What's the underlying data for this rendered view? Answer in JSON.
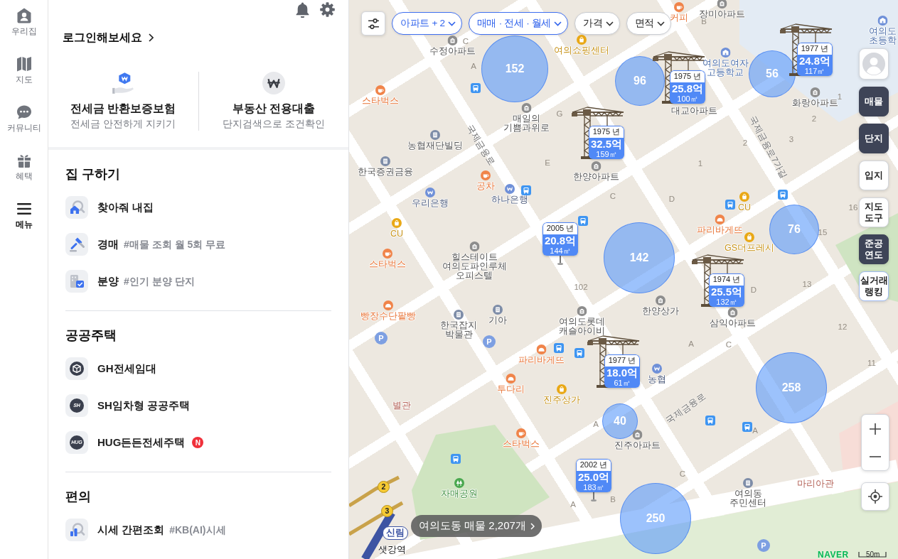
{
  "nav_rail": {
    "items": [
      {
        "kind": "home",
        "label": "우리집",
        "selected": false
      },
      {
        "kind": "map",
        "label": "지도",
        "selected": false
      },
      {
        "kind": "community",
        "label": "커뮤니티",
        "selected": false
      },
      {
        "kind": "benefit",
        "label": "혜택",
        "selected": false
      },
      {
        "kind": "menu",
        "label": "메뉴",
        "selected": true
      }
    ]
  },
  "menu_panel": {
    "login_link": "로그인해보세요",
    "promos": [
      {
        "kind": "insurance",
        "title": "전세금 반환보증보험",
        "subtitle": "전세금 안전하게 지키기"
      },
      {
        "kind": "loan",
        "title": "부동산 전용대출",
        "subtitle": "단지검색으로 조건확인"
      }
    ],
    "sections": [
      {
        "title": "집 구하기",
        "items": [
          {
            "kind": "findhome",
            "label": "찾아줘 내집"
          },
          {
            "kind": "auction",
            "label": "경매",
            "tag": "#매물 조회 월 5회 무료"
          },
          {
            "kind": "presale",
            "label": "분양",
            "tag": "#인기 분양 단지"
          }
        ]
      },
      {
        "title": "공공주택",
        "items": [
          {
            "kind": "gh",
            "label": "GH전세임대"
          },
          {
            "kind": "logo",
            "logo": "SH",
            "label": "SH임차형 공공주택"
          },
          {
            "kind": "logo",
            "logo": "HUG",
            "label": "HUG든든전세주택",
            "badge": "N"
          }
        ]
      },
      {
        "title": "편의",
        "items": [
          {
            "kind": "price",
            "label": "시세 간편조회",
            "tag": "#KB(AI)시세"
          }
        ]
      }
    ]
  },
  "map": {
    "filters": [
      {
        "label": "아파트 + 2",
        "selected": true
      },
      {
        "label": "매매 · 전세 · 월세",
        "selected": true
      },
      {
        "label": "가격",
        "selected": false
      },
      {
        "label": "면적",
        "selected": false
      }
    ],
    "layers": [
      {
        "label": "매물",
        "selected": true,
        "highlighted": false
      },
      {
        "label": "단지",
        "selected": true,
        "highlighted": false
      },
      {
        "label": "입지",
        "selected": false,
        "highlighted": false
      },
      {
        "label": "지도 도구",
        "selected": false,
        "highlighted": false
      },
      {
        "label": "준공 연도",
        "selected": true,
        "highlighted": false
      },
      {
        "label": "실거래 랭킹",
        "selected": false,
        "highlighted": true
      }
    ],
    "clusters": [
      {
        "count": "152"
      },
      {
        "count": "96"
      },
      {
        "count": "56"
      },
      {
        "count": "76"
      },
      {
        "count": "142"
      },
      {
        "count": "258"
      },
      {
        "count": "40"
      },
      {
        "count": "250"
      }
    ],
    "price_markers": [
      {
        "year": "1977 년",
        "price": "24.8억",
        "area": "117㎡",
        "crane": true
      },
      {
        "year": "1975 년",
        "price": "25.8억",
        "area": "100㎡",
        "crane": true
      },
      {
        "year": "1975 년",
        "price": "32.5억",
        "area": "159㎡",
        "crane": true
      },
      {
        "year": "2005 년",
        "price": "20.8억",
        "area": "144㎡",
        "crane": false
      },
      {
        "year": "1974 년",
        "price": "25.5억",
        "area": "132㎡",
        "crane": true
      },
      {
        "year": "1977 년",
        "price": "18.0억",
        "area": "61㎡",
        "crane": true
      },
      {
        "year": "2002 년",
        "price": "25.0억",
        "area": "183㎡",
        "crane": false
      }
    ],
    "places": [
      {
        "kind": "cafe",
        "name": "커피"
      },
      {
        "kind": "apartment",
        "name": "장미아파트"
      },
      {
        "kind": "school",
        "name": "여의도\n초등학"
      },
      {
        "kind": "apartment",
        "name": "수정아파트"
      },
      {
        "kind": "store",
        "name": "여의쇼핑센터"
      },
      {
        "kind": "school",
        "name": "여의도여자\n고등학교"
      },
      {
        "kind": "cafe",
        "name": "스타벅스"
      },
      {
        "kind": "apartment",
        "name": "매일의\n기쁨과위로"
      },
      {
        "kind": "name",
        "name": "대교아파트"
      },
      {
        "kind": "apartment",
        "name": "화랑아파트"
      },
      {
        "kind": "building",
        "name": "농협재단빌딩"
      },
      {
        "kind": "building",
        "name": "한국증권금융"
      },
      {
        "kind": "apartment",
        "name": "한양아파트"
      },
      {
        "kind": "cafe",
        "name": "공차"
      },
      {
        "kind": "bank",
        "name": "우리은행"
      },
      {
        "kind": "bank",
        "name": "하나은행"
      },
      {
        "kind": "store",
        "name": "CU"
      },
      {
        "kind": "store",
        "name": "CU"
      },
      {
        "kind": "bakery",
        "name": "파리바게뜨"
      },
      {
        "kind": "store",
        "name": "GS더프레시"
      },
      {
        "kind": "cafe",
        "name": "스타벅스"
      },
      {
        "kind": "apartment",
        "name": "힐스테이트\n여의도파인루체\n오피스텔"
      },
      {
        "kind": "bakery",
        "name": "빵장수단팥빵"
      },
      {
        "kind": "building",
        "name": "한국잡지\n박물관"
      },
      {
        "kind": "building",
        "name": "기아"
      },
      {
        "kind": "apartment",
        "name": "여의도롯데\n캐슬아이비"
      },
      {
        "kind": "apartment",
        "name": "한양상가"
      },
      {
        "kind": "apartment",
        "name": "삼익아파트"
      },
      {
        "kind": "bakery",
        "name": "파리바게뜨"
      },
      {
        "kind": "bank",
        "name": "농협"
      },
      {
        "kind": "bakery",
        "name": "투다리"
      },
      {
        "kind": "hall",
        "name": "별관"
      },
      {
        "kind": "store",
        "name": "진주상가"
      },
      {
        "kind": "cafe",
        "name": "스타벅스"
      },
      {
        "kind": "apartment",
        "name": "진주아파트"
      },
      {
        "kind": "hall",
        "name": "마리아관"
      },
      {
        "kind": "park",
        "name": "자매공원"
      },
      {
        "kind": "building",
        "name": "여의동\n주민센터"
      }
    ],
    "streets": [
      {
        "name": "국제금융로"
      },
      {
        "name": "국제금융로7가길"
      },
      {
        "name": "국제금융로"
      }
    ],
    "block_numbers": [
      "B",
      "C",
      "A",
      "1",
      "G",
      "2",
      "2",
      "3",
      "E",
      "1",
      "C",
      "D",
      "16",
      "15",
      "102",
      "D",
      "13",
      "12",
      "A",
      "C",
      "11",
      "A",
      "A",
      "C",
      "A",
      "B"
    ],
    "parking": [
      {
        "label": "P"
      },
      {
        "label": "P"
      },
      {
        "label": "P"
      }
    ],
    "subway": {
      "line_badges": [
        {
          "label": "2"
        },
        {
          "label": "3"
        }
      ],
      "line_tag": "신림",
      "station": "샛강역"
    },
    "listing_summary": "여의도동 매물 2,207개",
    "provider": "NAVER",
    "scale": "50m"
  }
}
